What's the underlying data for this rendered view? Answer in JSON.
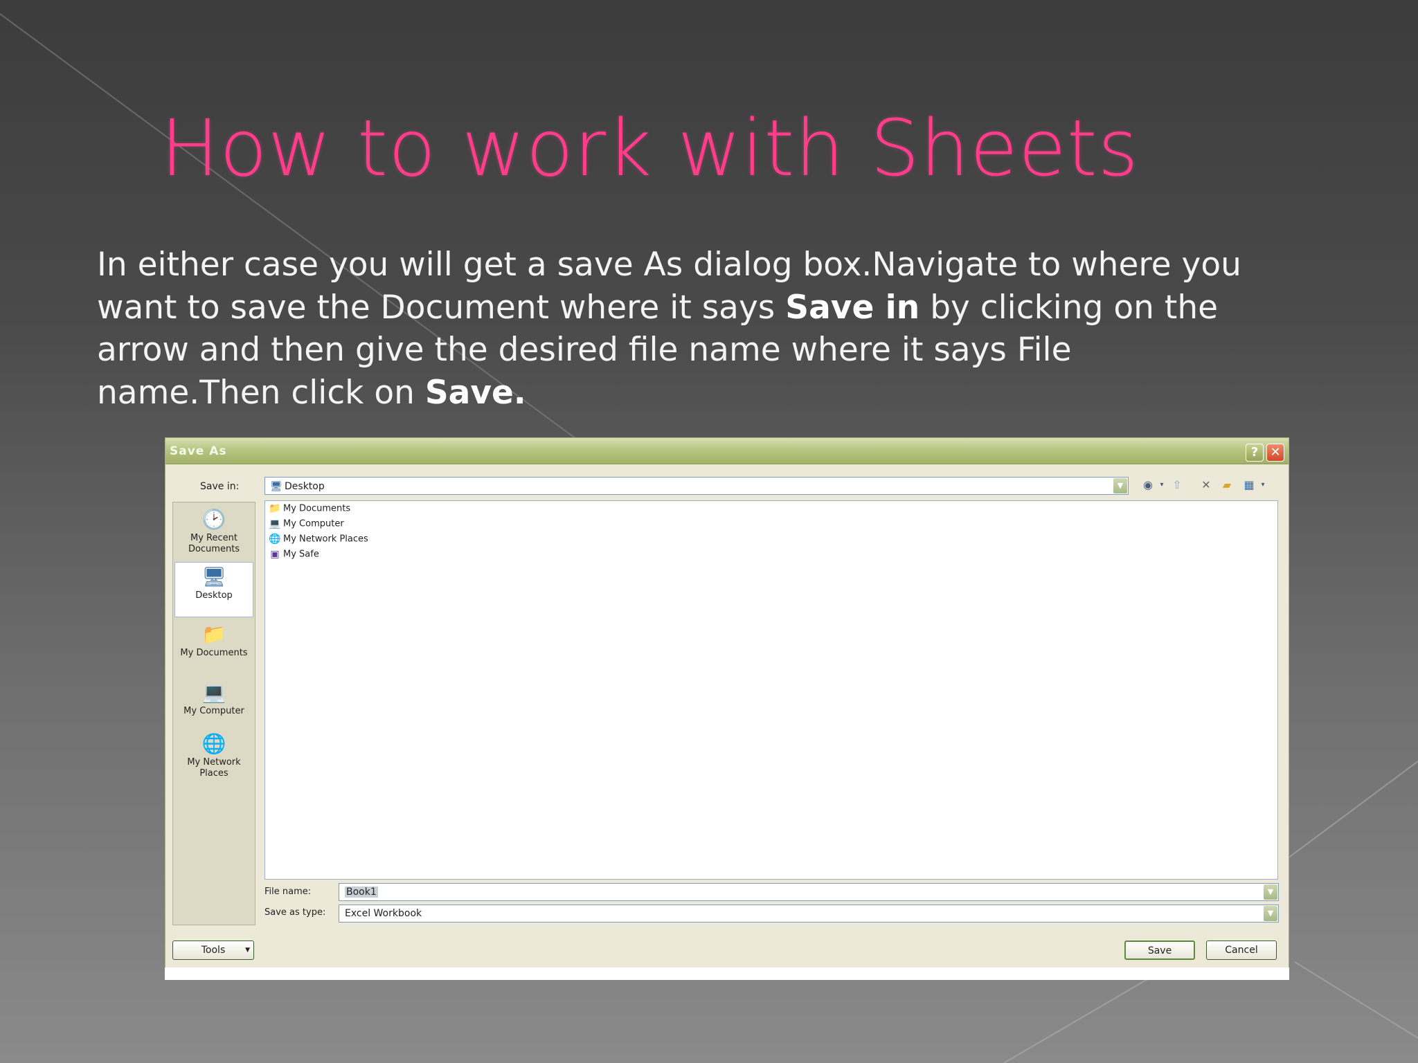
{
  "slide": {
    "title": "How to work with Sheets",
    "body_1": "In either case you will get a save As dialog box.Navigate to where you want to save the Document where it says ",
    "body_bold_1": "Save in",
    "body_2": " by clicking on the arrow and then give the desired file name where it says File name.Then click on ",
    "body_bold_2": "Save."
  },
  "dialog": {
    "title": "Save As",
    "help_glyph": "?",
    "close_glyph": "✕",
    "save_in_label": "Save in:",
    "save_in_value": "Desktop",
    "places": [
      {
        "label": "My Recent Documents",
        "icon": "recent-documents-icon"
      },
      {
        "label": "Desktop",
        "icon": "desktop-icon"
      },
      {
        "label": "My Documents",
        "icon": "my-documents-icon"
      },
      {
        "label": "My Computer",
        "icon": "my-computer-icon"
      },
      {
        "label": "My Network Places",
        "icon": "network-places-icon"
      }
    ],
    "files": [
      {
        "name": "My Documents",
        "icon": "folder-icon"
      },
      {
        "name": "My Computer",
        "icon": "computer-icon"
      },
      {
        "name": "My Network Places",
        "icon": "network-icon"
      },
      {
        "name": "My Safe",
        "icon": "safe-icon"
      }
    ],
    "file_name_label": "File name:",
    "file_name_value": "Book1",
    "save_type_label": "Save as type:",
    "save_type_value": "Excel Workbook",
    "tools_label": "Tools",
    "save_label": "Save",
    "cancel_label": "Cancel"
  },
  "colors": {
    "title": "#ff3d8b",
    "dialog_bg": "#ece9d8",
    "titlebar": "#a2b067"
  }
}
